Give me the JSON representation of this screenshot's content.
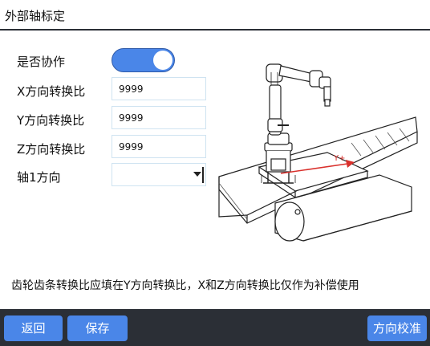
{
  "window": {
    "title": "外部轴标定"
  },
  "form": {
    "cooperate_label": "是否协作",
    "cooperate_on": true,
    "x_ratio_label": "X方向转换比",
    "x_ratio_value": "9999",
    "y_ratio_label": "Y方向转换比",
    "y_ratio_value": "9999",
    "z_ratio_label": "Z方向转换比",
    "z_ratio_value": "9999",
    "axis1_dir_label": "轴1方向",
    "axis1_dir_value": ""
  },
  "diagram": {
    "axis_label": "Y+"
  },
  "note": "齿轮齿条转换比应填在Y方向转换比，X和Z方向转换比仅作为补偿使用",
  "buttons": {
    "back": "返回",
    "save": "保存",
    "calibrate": "方向校准"
  },
  "colors": {
    "accent": "#4a86e8",
    "bar": "#2b2f36",
    "axis_arrow": "#d9302c"
  }
}
